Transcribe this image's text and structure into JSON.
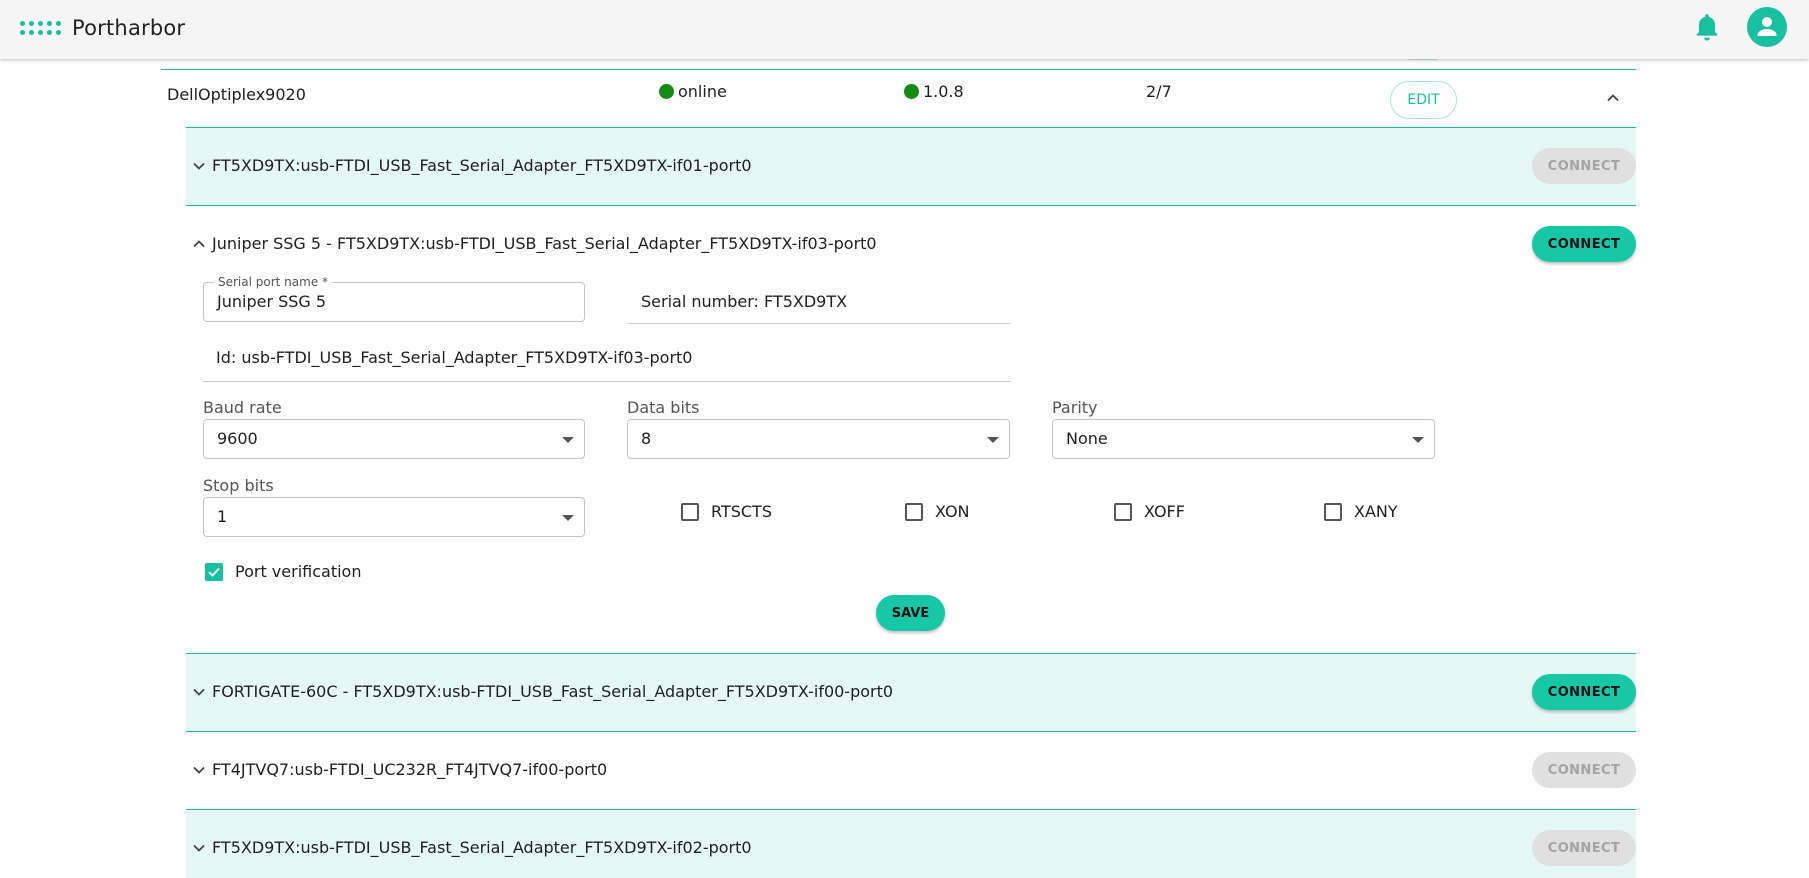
{
  "app": {
    "name": "Portharbor"
  },
  "device": {
    "name": "DellOptiplex9020",
    "status": "online",
    "version": "1.0.8",
    "ports_count": "2/7",
    "edit_label": "EDIT",
    "status_color": "#158a15"
  },
  "ports": [
    {
      "title": "FT5XD9TX:usb-FTDI_USB_Fast_Serial_Adapter_FT5XD9TX-if01-port0",
      "connect_label": "CONNECT",
      "connect_enabled": false,
      "expanded": false
    },
    {
      "title": "Juniper SSG 5 - FT5XD9TX:usb-FTDI_USB_Fast_Serial_Adapter_FT5XD9TX-if03-port0",
      "connect_label": "CONNECT",
      "connect_enabled": true,
      "expanded": true
    },
    {
      "title": "FORTIGATE-60C - FT5XD9TX:usb-FTDI_USB_Fast_Serial_Adapter_FT5XD9TX-if00-port0",
      "connect_label": "CONNECT",
      "connect_enabled": true,
      "expanded": false
    },
    {
      "title": "FT4JTVQ7:usb-FTDI_UC232R_FT4JTVQ7-if00-port0",
      "connect_label": "CONNECT",
      "connect_enabled": false,
      "expanded": false
    },
    {
      "title": "FT5XD9TX:usb-FTDI_USB_Fast_Serial_Adapter_FT5XD9TX-if02-port0",
      "connect_label": "CONNECT",
      "connect_enabled": false,
      "expanded": false
    }
  ],
  "details": {
    "serial_port_name_label": "Serial port name *",
    "serial_port_name_value": "Juniper SSG 5",
    "serial_number": "Serial number: FT5XD9TX",
    "id": "Id: usb-FTDI_USB_Fast_Serial_Adapter_FT5XD9TX-if03-port0",
    "baud_rate_label": "Baud rate",
    "baud_rate_value": "9600",
    "data_bits_label": "Data bits",
    "data_bits_value": "8",
    "parity_label": "Parity",
    "parity_value": "None",
    "stop_bits_label": "Stop bits",
    "stop_bits_value": "1",
    "checkboxes": [
      {
        "label": "RTSCTS",
        "checked": false
      },
      {
        "label": "XON",
        "checked": false
      },
      {
        "label": "XOFF",
        "checked": false
      },
      {
        "label": "XANY",
        "checked": false
      }
    ],
    "port_verification_label": "Port verification",
    "port_verification_checked": true,
    "save_label": "SAVE"
  },
  "colors": {
    "accent": "#18bfa0",
    "row_tint": "#e6f8f4",
    "disabled_bg": "#e0e0e0"
  },
  "icons": {
    "bell": "bell-icon",
    "user": "user-icon",
    "logo": "logo-dots-icon"
  }
}
